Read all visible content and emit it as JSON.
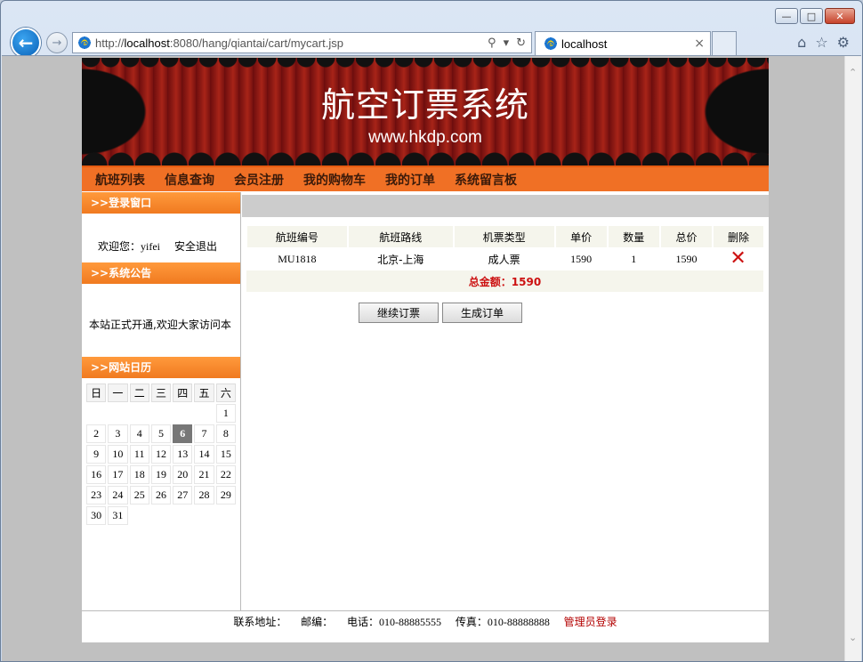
{
  "browser": {
    "url_prefix": "http://",
    "url_host": "localhost",
    "url_rest": ":8080/hang/qiantai/cart/mycart.jsp",
    "tab_title": "localhost",
    "tab_close": "×"
  },
  "site": {
    "title": "航空订票系统",
    "subtitle": "www.hkdp.com",
    "nav": [
      "航班列表",
      "信息查询",
      "会员注册",
      "我的购物车",
      "我的订单",
      "系统留言板"
    ]
  },
  "sidebar": {
    "login_head": ">>登录窗口",
    "welcome_label": "欢迎您：",
    "username": "yifei",
    "logout": "安全退出",
    "notice_head": ">>系统公告",
    "notice_text": "本站正式开通,欢迎大家访问本",
    "calendar_head": ">>网站日历",
    "weekdays": [
      "日",
      "一",
      "二",
      "三",
      "四",
      "五",
      "六"
    ],
    "weeks": [
      [
        "",
        "",
        "",
        "",
        "",
        "",
        "1"
      ],
      [
        "2",
        "3",
        "4",
        "5",
        "6",
        "7",
        "8"
      ],
      [
        "9",
        "10",
        "11",
        "12",
        "13",
        "14",
        "15"
      ],
      [
        "16",
        "17",
        "18",
        "19",
        "20",
        "21",
        "22"
      ],
      [
        "23",
        "24",
        "25",
        "26",
        "27",
        "28",
        "29"
      ],
      [
        "30",
        "31",
        "",
        "",
        "",
        "",
        ""
      ]
    ],
    "today": "6"
  },
  "cart": {
    "headers": [
      "航班编号",
      "航班路线",
      "机票类型",
      "单价",
      "数量",
      "总价",
      "删除"
    ],
    "rows": [
      {
        "flight_no": "MU1818",
        "route": "北京-上海",
        "ticket_type": "成人票",
        "unit_price": "1590",
        "quantity": "1",
        "total": "1590"
      }
    ],
    "total_label": "总金额：1590",
    "continue_button": "继续订票",
    "order_button": "生成订单"
  },
  "footer": {
    "address": "联系地址：",
    "postcode": "邮编：",
    "phone": "电话：010-88885555",
    "fax": "传真：010-88888888",
    "admin_login": "管理员登录"
  },
  "colors": {
    "nav_bg": "#f07025",
    "side_head": "#f07a20",
    "total_text": "#cc1111"
  }
}
